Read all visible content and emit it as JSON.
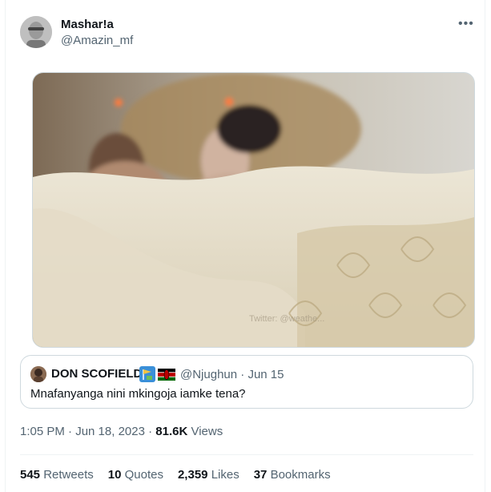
{
  "tweet": {
    "author_name": "Mashar!a",
    "author_handle": "@Amazin_mf",
    "more_icon": "more-icon",
    "image_alt": "blurred image of two women in a bed smoking",
    "image_watermark": "Twitter: @weathe..."
  },
  "quoted": {
    "author_name": "DON SCOFIELD",
    "icons": [
      "construction-flag-icon",
      "kenya-flag-icon"
    ],
    "handle": "@Njughun",
    "separator": " · ",
    "date": "Jun 15",
    "text": "Mnafanyanga nini mkingoja iamke tena?"
  },
  "meta": {
    "time": "1:05 PM · Jun 18, 2023 · ",
    "views_count": "81.6K",
    "views_label": " Views"
  },
  "stats": [
    {
      "count": "545",
      "label": "Retweets"
    },
    {
      "count": "10",
      "label": "Quotes"
    },
    {
      "count": "2,359",
      "label": "Likes"
    },
    {
      "count": "37",
      "label": "Bookmarks"
    }
  ],
  "colors": {
    "text": "#0f1419",
    "secondary": "#536471",
    "border": "#cfd9de",
    "divider": "#eff3f4"
  }
}
